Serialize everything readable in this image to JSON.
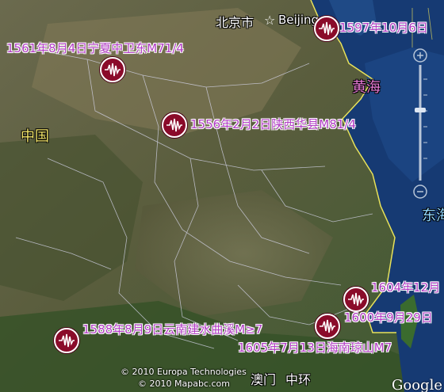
{
  "map": {
    "places": {
      "beijing_cn": "北京市",
      "beijing_en": "Beijing",
      "yellow_sea": "黄海",
      "china": "中国",
      "east_sea": "东海",
      "macau": "澳门",
      "central": "中环"
    },
    "events": [
      {
        "id": "1597",
        "label": "1597年10月6日"
      },
      {
        "id": "1561",
        "label": "1561年8月4日宁夏中卫东M71/4"
      },
      {
        "id": "1556",
        "label": "1556年2月2日陕西华县M81/4"
      },
      {
        "id": "1604",
        "label": "1604年12月"
      },
      {
        "id": "1600",
        "label": "1600年9月29日"
      },
      {
        "id": "1588",
        "label": "1588年8月9日云南建水曲溪M≥7"
      },
      {
        "id": "1605",
        "label": "1605年7月13日海南琼山M7"
      }
    ],
    "copyright": [
      "© 2010 Europa Technologies",
      "© 2010 Mapabc.com"
    ],
    "brand": "Google",
    "colors": {
      "label": "#b13cc4",
      "marker": "#8a0b2a",
      "sea": "#163a73"
    }
  }
}
